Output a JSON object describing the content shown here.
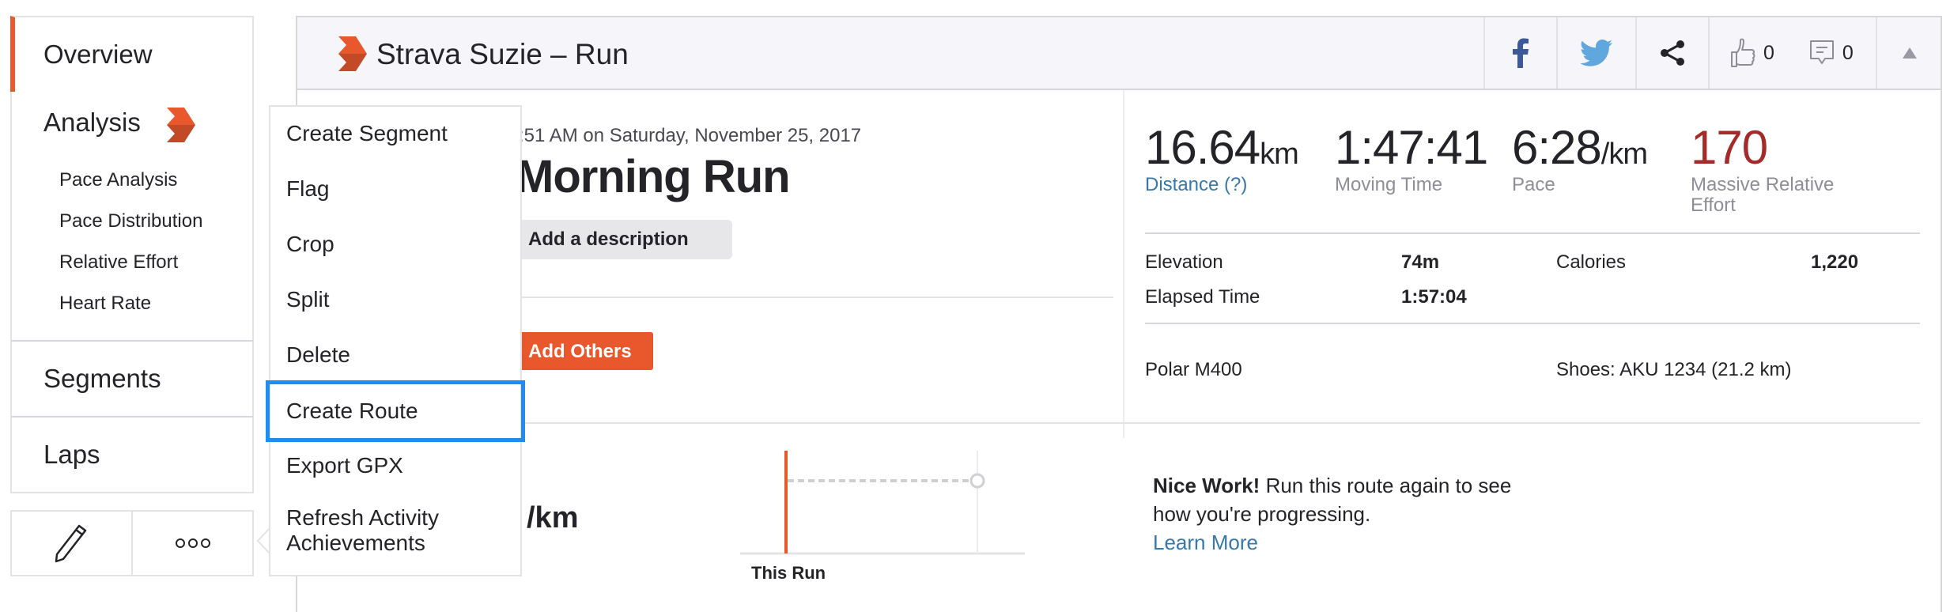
{
  "sidebar": {
    "overview": "Overview",
    "analysis": "Analysis",
    "analysis_items": [
      "Pace Analysis",
      "Pace Distribution",
      "Relative Effort",
      "Heart Rate"
    ],
    "segments": "Segments",
    "laps": "Laps",
    "actions": {
      "edit_icon": "pencil-icon",
      "more_icon": "ellipsis-icon"
    }
  },
  "header": {
    "title": "Strava Suzie – Run",
    "kudos_count": "0",
    "comment_count": "0",
    "icons": [
      "facebook-icon",
      "twitter-icon",
      "share-icon",
      "thumbs-up-icon",
      "comment-icon",
      "collapse-icon"
    ]
  },
  "activity": {
    "date": ":51 AM on Saturday, November 25, 2017",
    "title": "Morning Run",
    "add_description": "Add a description",
    "add_others": "Add Others"
  },
  "stats": {
    "distance": {
      "value": "16.64",
      "unit": "km",
      "label": "Distance (?)"
    },
    "moving_time": {
      "value": "1:47:41",
      "label": "Moving Time"
    },
    "pace": {
      "value": "6:28",
      "unit": "/km",
      "label": "Pace"
    },
    "relative_effort": {
      "value": "170",
      "label": "Massive Relative Effort"
    },
    "elevation_label": "Elevation",
    "elevation_value": "74m",
    "calories_label": "Calories",
    "calories_value": "1,220",
    "elapsed_label": "Elapsed Time",
    "elapsed_value": "1:57:04",
    "device": "Polar M400",
    "shoes": "Shoes: AKU 1234 (21.2 km)"
  },
  "comparison": {
    "pace_fragment": "/km",
    "chart_label": "This Run",
    "nice_bold": "Nice Work!",
    "nice_text": " Run this route again to see how you're progressing.",
    "learn_more": "Learn More"
  },
  "menu": {
    "items": [
      "Create Segment",
      "Flag",
      "Crop",
      "Split",
      "Delete",
      "Create Route",
      "Export GPX",
      "Refresh Activity Achievements"
    ],
    "selected": "Create Route"
  },
  "colors": {
    "brand": "#e8582c",
    "link": "#3778a8",
    "effort": "#a52a2a",
    "focus": "#1e8cf0"
  }
}
